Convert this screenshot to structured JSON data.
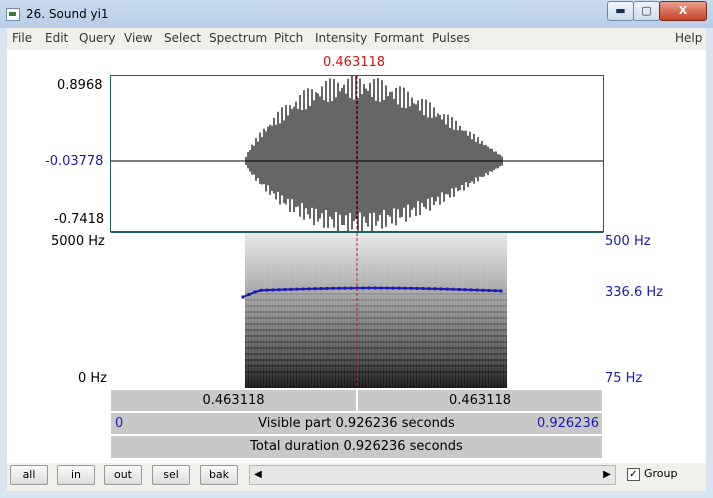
{
  "window": {
    "title": "26. Sound yi1",
    "minimize": "▬",
    "maximize": "▢",
    "close": "X"
  },
  "menu": [
    "File",
    "Edit",
    "Query",
    "View",
    "Select",
    "Spectrum",
    "Pitch",
    "Intensity",
    "Formant",
    "Pulses",
    "Help"
  ],
  "cursor": {
    "time": "0.463118"
  },
  "waveform": {
    "max": "0.8968",
    "mid": "-0.03778",
    "min": "-0.7418"
  },
  "spectrogram": {
    "freq_top": "5000 Hz",
    "freq_bottom": "0 Hz",
    "pitch_top": "500 Hz",
    "pitch_value": "336.6 Hz",
    "pitch_bottom": "75 Hz"
  },
  "bars": {
    "left_time": "0.463118",
    "right_time": "0.463118",
    "visible_start": "0",
    "visible_label": "Visible part 0.926236 seconds",
    "visible_end": "0.926236",
    "total_label": "Total duration 0.926236 seconds"
  },
  "buttons": {
    "all": "all",
    "in": "in",
    "out": "out",
    "sel": "sel",
    "bak": "bak"
  },
  "scroll": {
    "left": "◀",
    "right": "▶"
  },
  "group": {
    "label": "Group",
    "checked": true,
    "check": "✓"
  },
  "colors": {
    "cursor": "#d11414",
    "pitch": "#1a1ab4",
    "axis": "#1c5f5f"
  }
}
